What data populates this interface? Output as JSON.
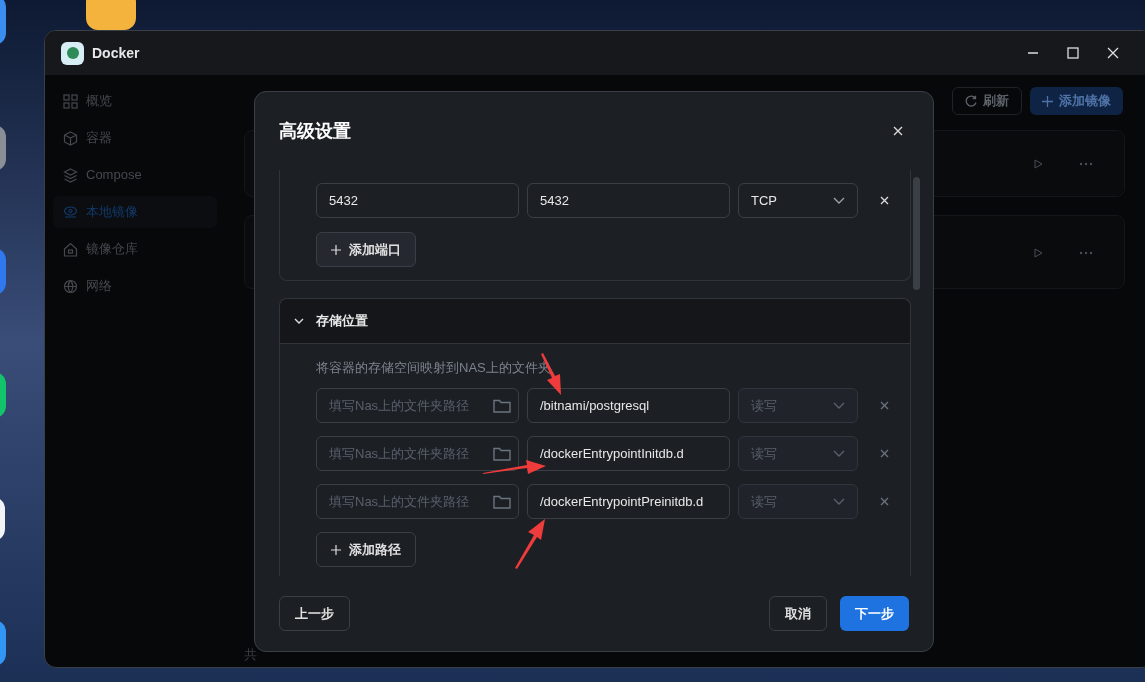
{
  "window": {
    "title": "Docker",
    "sidebar": {
      "items": [
        {
          "label": "概览",
          "selected": false
        },
        {
          "label": "容器",
          "selected": false
        },
        {
          "label": "Compose",
          "selected": false
        },
        {
          "label": "本地镜像",
          "selected": true
        },
        {
          "label": "镜像仓库",
          "selected": false
        },
        {
          "label": "网络",
          "selected": false
        }
      ]
    },
    "toolbar": {
      "buttons": [
        "刷新",
        "添加镜像"
      ]
    },
    "footer": "共"
  },
  "dialog": {
    "title": "高级设置",
    "ports": [
      {
        "host": "5432",
        "container": "5432",
        "protocol": "TCP"
      }
    ],
    "add_port": "添加端口",
    "storage": {
      "title": "存储位置",
      "expanded": true,
      "description": "将容器的存储空间映射到NAS上的文件夹",
      "rows": [
        {
          "placeholder": "填写Nas上的文件夹路径",
          "container_path": "/bitnami/postgresql",
          "mode": "读写",
          "disabled": true
        },
        {
          "placeholder": "填写Nas上的文件夹路径",
          "container_path": "/dockerEntrypointInitdb.d",
          "mode": "读写",
          "disabled": true
        },
        {
          "placeholder": "填写Nas上的文件夹路径",
          "container_path": "/dockerEntrypointPreinitdb.d",
          "mode": "读写",
          "disabled": true
        }
      ],
      "add_path": "添加路径"
    },
    "buttons": {
      "back": "上一步",
      "cancel": "取消",
      "next": "下一步"
    }
  }
}
